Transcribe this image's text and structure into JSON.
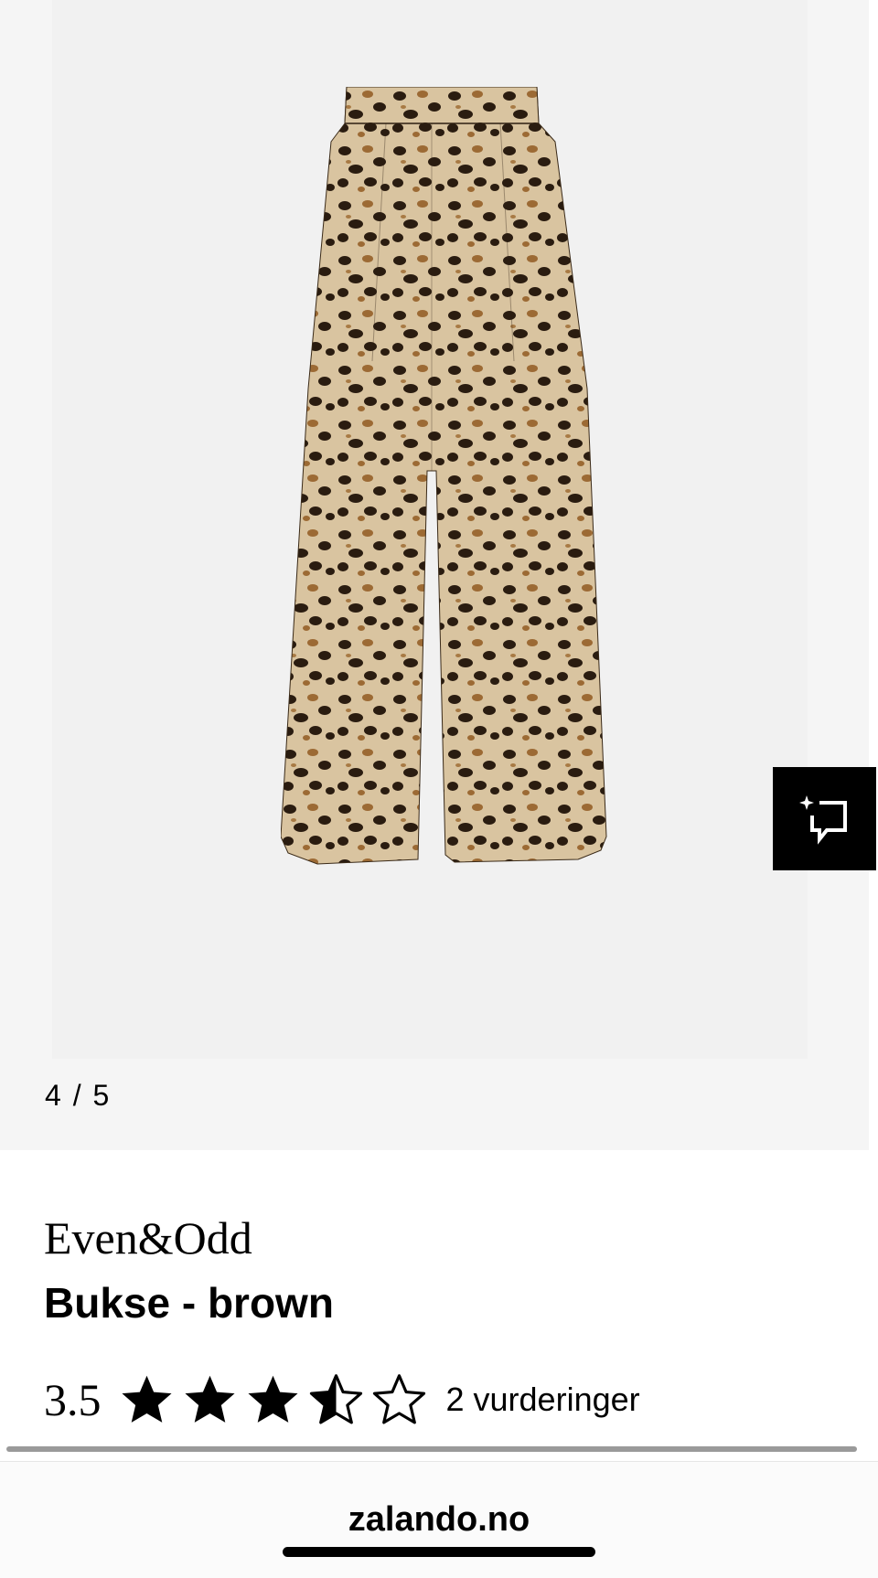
{
  "gallery": {
    "counter": "4 / 5",
    "image_description_icon": "leopard-print-trousers-image"
  },
  "ai_button": {
    "icon": "sparkle-chat-icon"
  },
  "product": {
    "brand": "Even&Odd",
    "title": "Bukse - brown",
    "rating_value": "3.5",
    "rating": 3.5,
    "rating_max": 5,
    "review_count": "2 vurderinger"
  },
  "browser": {
    "url": "zalando.no"
  },
  "colors": {
    "gallery_bg": "#f5f5f5",
    "accent": "#000000"
  }
}
